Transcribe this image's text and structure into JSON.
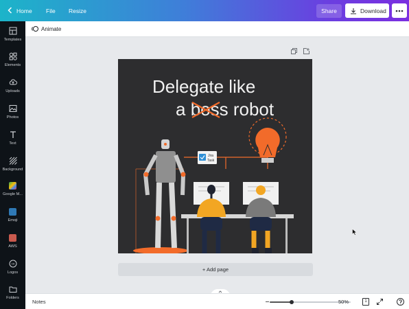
{
  "topbar": {
    "home_label": "Home",
    "file_label": "File",
    "resize_label": "Resize",
    "share_label": "Share",
    "download_label": "Download",
    "gradient": [
      "#1cb4c9",
      "#3f7ed9",
      "#6a3fe0",
      "#7b2fe0"
    ]
  },
  "sidebar": {
    "items": [
      {
        "label": "Templates",
        "icon": "templates-icon"
      },
      {
        "label": "Elements",
        "icon": "elements-icon"
      },
      {
        "label": "Uploads",
        "icon": "uploads-icon"
      },
      {
        "label": "Photos",
        "icon": "photos-icon"
      },
      {
        "label": "Text",
        "icon": "text-icon"
      },
      {
        "label": "Background",
        "icon": "background-icon"
      },
      {
        "label": "Google M...",
        "icon": "google-maps-icon"
      },
      {
        "label": "Emoji",
        "icon": "emoji-icon"
      },
      {
        "label": "AWS",
        "icon": "aws-icon"
      },
      {
        "label": "Logos",
        "icon": "logos-icon"
      },
      {
        "label": "Folders",
        "icon": "folders-icon"
      }
    ]
  },
  "subbar": {
    "animate_label": "Animate"
  },
  "design": {
    "headline_line1": "Delegate like",
    "headline_line2_a": "a ",
    "headline_struck": "boss",
    "headline_line2_b": " robot",
    "task_card_label": "Jira Task",
    "colors": {
      "background": "#2d2d2f",
      "accent": "#f26b2a",
      "robot": "#c9c9c9",
      "bulb": "#f26b2a",
      "person1": "#f2a623",
      "person2": "#7a7a7a"
    }
  },
  "add_page_label": "+ Add page",
  "bottombar": {
    "notes_label": "Notes",
    "zoom_value": "50%",
    "zoom_fraction": 0.5,
    "page_count": "1"
  }
}
